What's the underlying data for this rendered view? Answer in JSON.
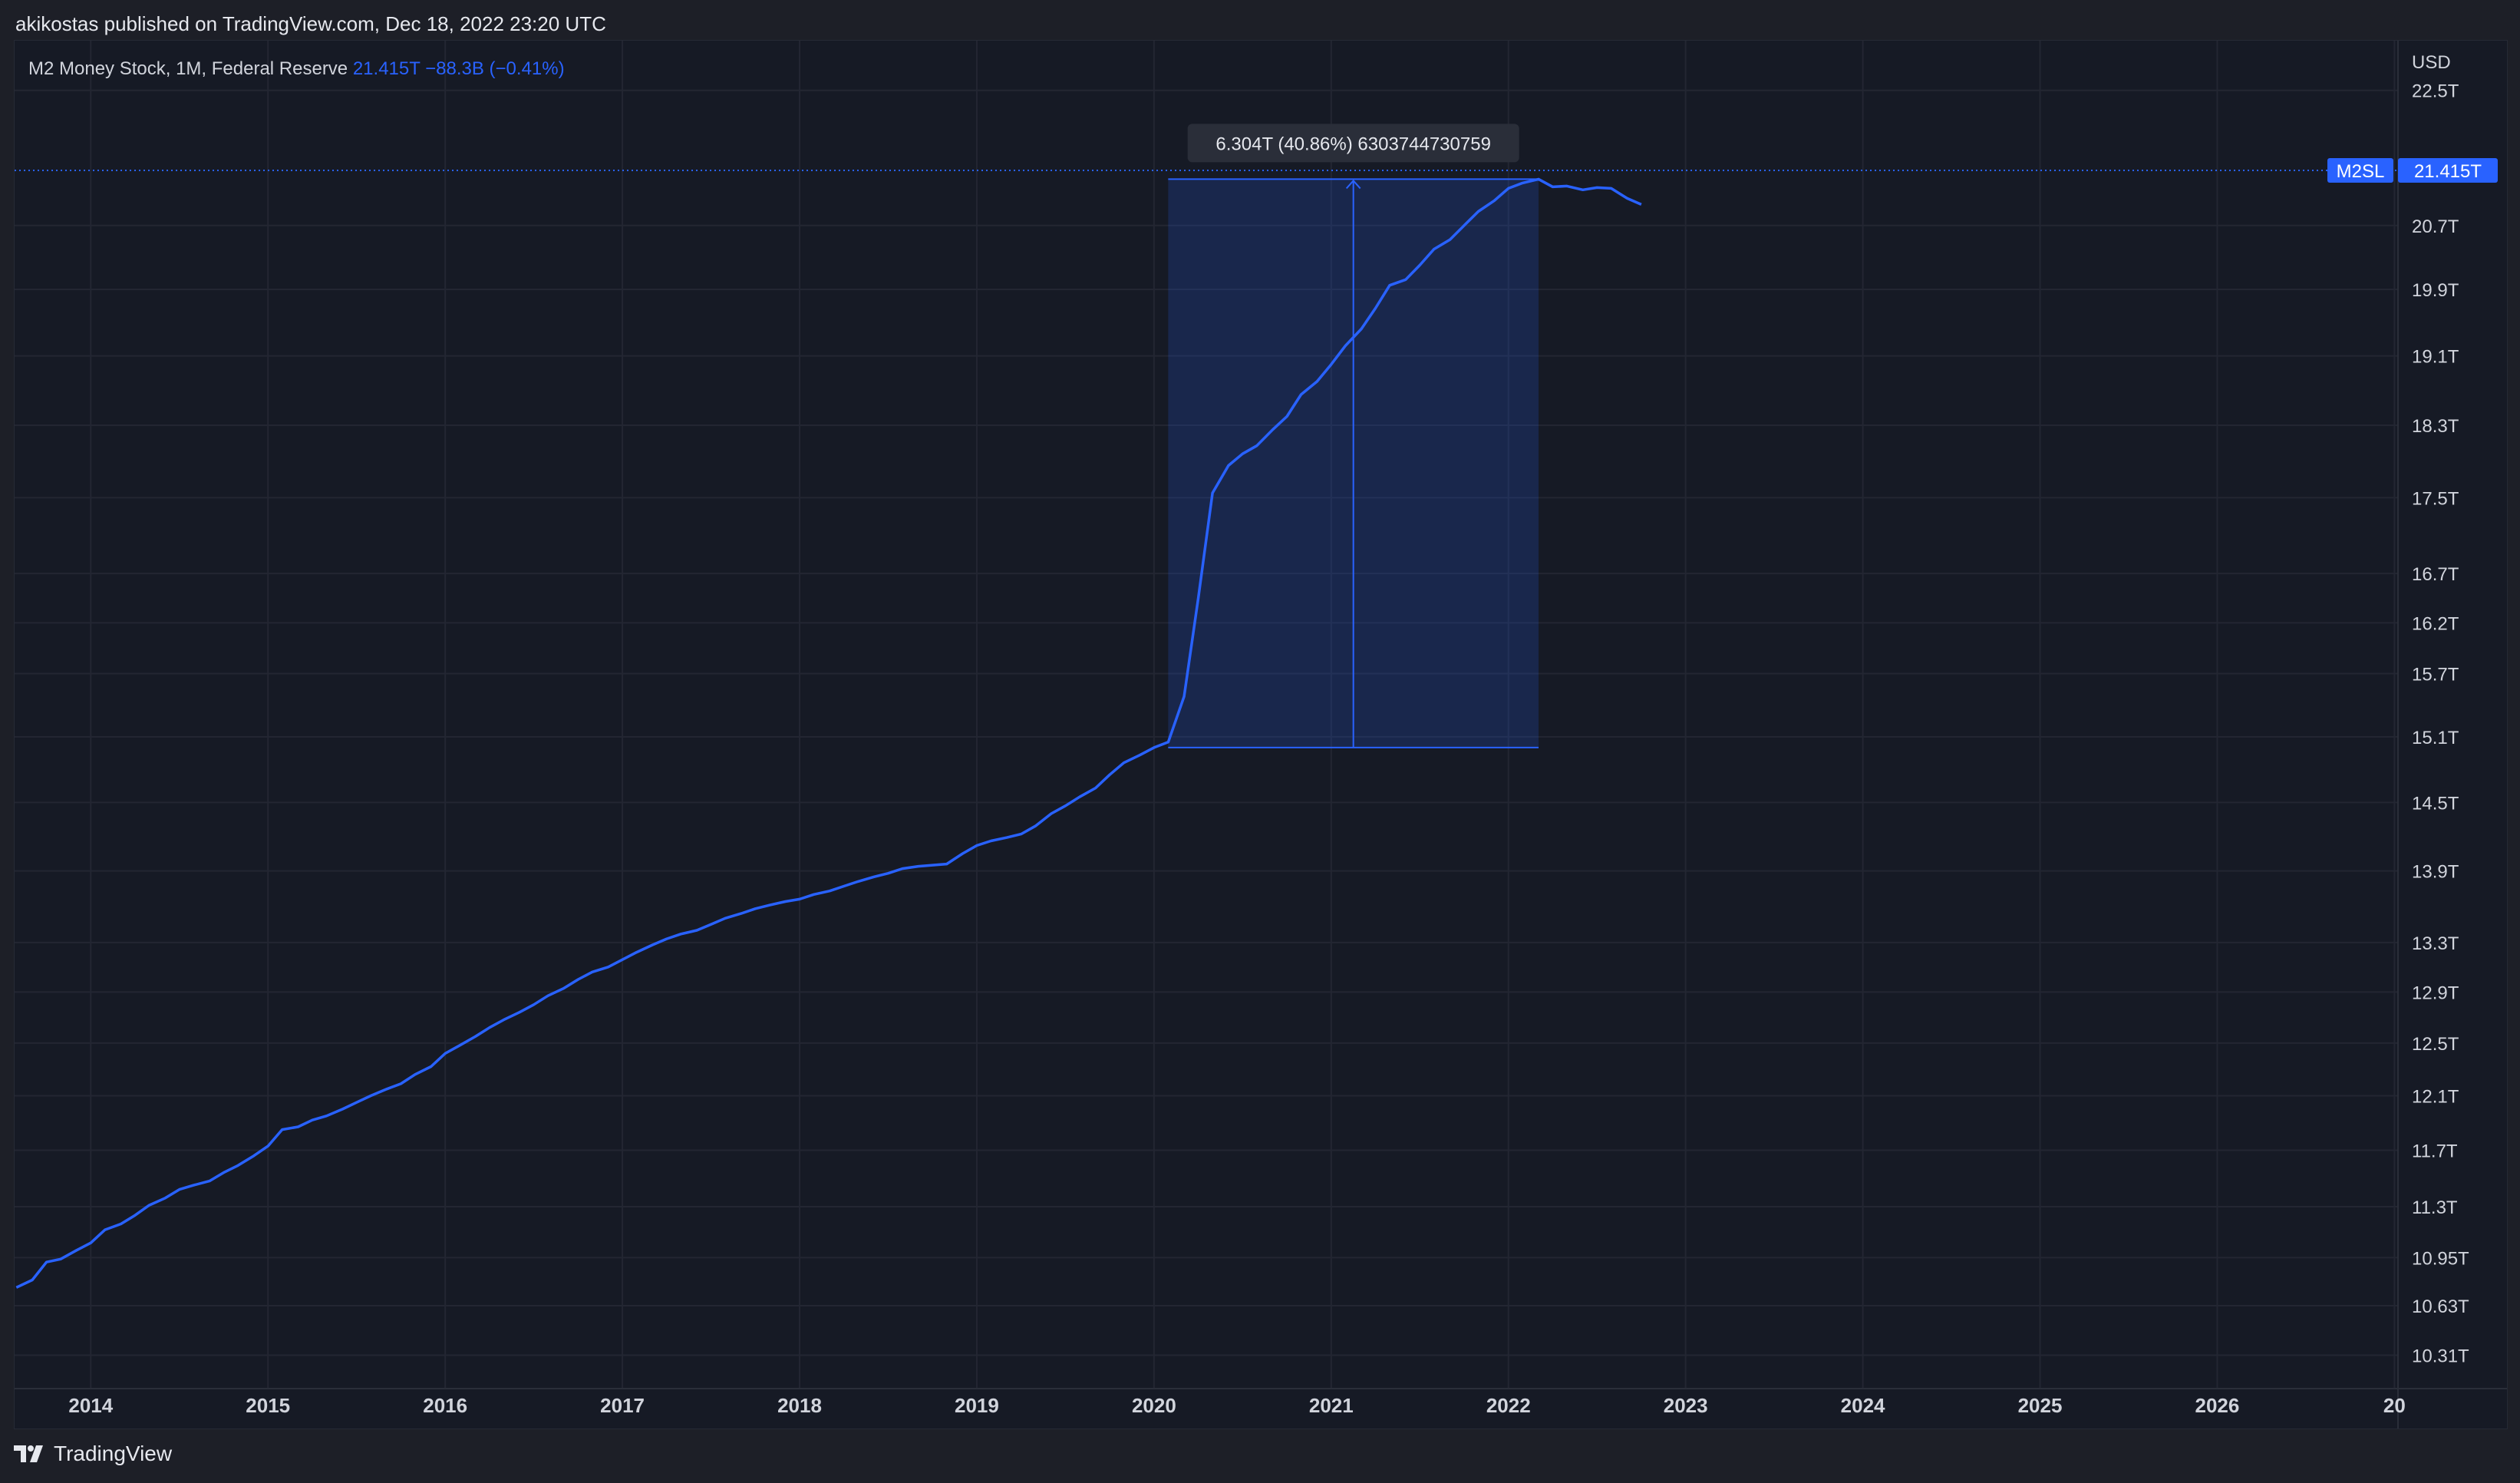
{
  "header": {
    "published_text": "akikostas published on TradingView.com, Dec 18, 2022 23:20 UTC"
  },
  "legend": {
    "title": "M2 Money Stock, 1M, Federal Reserve",
    "last_value": "21.415T",
    "change": "−88.3B (−0.41%)"
  },
  "price_scale": {
    "currency": "USD",
    "symbol_badge": "M2SL",
    "last_badge": "21.415T"
  },
  "measure_label": "6.304T (40.86%) 6303744730759",
  "footer": {
    "brand": "TradingView"
  },
  "colors": {
    "background": "#161a25",
    "series": "#2962ff",
    "grid": "#232632",
    "axis_text": "#d1d4dc",
    "measure_fill": "#2962ff",
    "badge": "#2962ff"
  },
  "chart_data": {
    "type": "line",
    "title": "M2 Money Stock, 1M, Federal Reserve",
    "ylabel": "USD",
    "y_scale": "log",
    "ylim": [
      10.1,
      23.2
    ],
    "y_ticks": [
      {
        "value": 22.5,
        "label": "22.5T"
      },
      {
        "value": 20.7,
        "label": "20.7T"
      },
      {
        "value": 19.9,
        "label": "19.9T"
      },
      {
        "value": 19.1,
        "label": "19.1T"
      },
      {
        "value": 18.3,
        "label": "18.3T"
      },
      {
        "value": 17.5,
        "label": "17.5T"
      },
      {
        "value": 16.7,
        "label": "16.7T"
      },
      {
        "value": 16.2,
        "label": "16.2T"
      },
      {
        "value": 15.7,
        "label": "15.7T"
      },
      {
        "value": 15.1,
        "label": "15.1T"
      },
      {
        "value": 14.5,
        "label": "14.5T"
      },
      {
        "value": 13.9,
        "label": "13.9T"
      },
      {
        "value": 13.3,
        "label": "13.3T"
      },
      {
        "value": 12.9,
        "label": "12.9T"
      },
      {
        "value": 12.5,
        "label": "12.5T"
      },
      {
        "value": 12.1,
        "label": "12.1T"
      },
      {
        "value": 11.7,
        "label": "11.7T"
      },
      {
        "value": 11.3,
        "label": "11.3T"
      },
      {
        "value": 10.95,
        "label": "10.95T"
      },
      {
        "value": 10.63,
        "label": "10.63T"
      },
      {
        "value": 10.31,
        "label": "10.31T"
      }
    ],
    "xlim": [
      2013.57,
      2027.02
    ],
    "x_ticks": [
      {
        "value": 2014,
        "label": "2014"
      },
      {
        "value": 2015,
        "label": "2015"
      },
      {
        "value": 2016,
        "label": "2016"
      },
      {
        "value": 2017,
        "label": "2017"
      },
      {
        "value": 2018,
        "label": "2018"
      },
      {
        "value": 2019,
        "label": "2019"
      },
      {
        "value": 2020,
        "label": "2020"
      },
      {
        "value": 2021,
        "label": "2021"
      },
      {
        "value": 2022,
        "label": "2022"
      },
      {
        "value": 2023,
        "label": "2023"
      },
      {
        "value": 2024,
        "label": "2024"
      },
      {
        "value": 2025,
        "label": "2025"
      },
      {
        "value": 2026,
        "label": "2026"
      },
      {
        "value": 2027,
        "label": "20"
      }
    ],
    "series": [
      {
        "points": [
          [
            2013.58,
            10.75
          ],
          [
            2013.67,
            10.8
          ],
          [
            2013.75,
            10.92
          ],
          [
            2013.83,
            10.94
          ],
          [
            2013.92,
            11.0
          ],
          [
            2014.0,
            11.05
          ],
          [
            2014.08,
            11.14
          ],
          [
            2014.17,
            11.18
          ],
          [
            2014.25,
            11.24
          ],
          [
            2014.33,
            11.31
          ],
          [
            2014.42,
            11.36
          ],
          [
            2014.5,
            11.42
          ],
          [
            2014.58,
            11.45
          ],
          [
            2014.67,
            11.48
          ],
          [
            2014.75,
            11.54
          ],
          [
            2014.83,
            11.59
          ],
          [
            2014.92,
            11.66
          ],
          [
            2015.0,
            11.73
          ],
          [
            2015.08,
            11.85
          ],
          [
            2015.17,
            11.87
          ],
          [
            2015.25,
            11.92
          ],
          [
            2015.33,
            11.95
          ],
          [
            2015.42,
            12.0
          ],
          [
            2015.5,
            12.05
          ],
          [
            2015.58,
            12.1
          ],
          [
            2015.67,
            12.15
          ],
          [
            2015.75,
            12.19
          ],
          [
            2015.83,
            12.26
          ],
          [
            2015.92,
            12.32
          ],
          [
            2016.0,
            12.42
          ],
          [
            2016.08,
            12.48
          ],
          [
            2016.17,
            12.55
          ],
          [
            2016.25,
            12.62
          ],
          [
            2016.33,
            12.68
          ],
          [
            2016.42,
            12.74
          ],
          [
            2016.5,
            12.8
          ],
          [
            2016.58,
            12.87
          ],
          [
            2016.67,
            12.93
          ],
          [
            2016.75,
            13.0
          ],
          [
            2016.83,
            13.06
          ],
          [
            2016.92,
            13.1
          ],
          [
            2017.0,
            13.16
          ],
          [
            2017.08,
            13.22
          ],
          [
            2017.17,
            13.28
          ],
          [
            2017.25,
            13.33
          ],
          [
            2017.33,
            13.37
          ],
          [
            2017.42,
            13.4
          ],
          [
            2017.5,
            13.45
          ],
          [
            2017.58,
            13.5
          ],
          [
            2017.67,
            13.54
          ],
          [
            2017.75,
            13.58
          ],
          [
            2017.83,
            13.61
          ],
          [
            2017.92,
            13.64
          ],
          [
            2018.0,
            13.66
          ],
          [
            2018.08,
            13.7
          ],
          [
            2018.17,
            13.73
          ],
          [
            2018.25,
            13.77
          ],
          [
            2018.33,
            13.81
          ],
          [
            2018.42,
            13.85
          ],
          [
            2018.5,
            13.88
          ],
          [
            2018.58,
            13.92
          ],
          [
            2018.67,
            13.94
          ],
          [
            2018.75,
            13.95
          ],
          [
            2018.83,
            13.96
          ],
          [
            2018.92,
            14.05
          ],
          [
            2019.0,
            14.12
          ],
          [
            2019.08,
            14.16
          ],
          [
            2019.17,
            14.19
          ],
          [
            2019.25,
            14.22
          ],
          [
            2019.33,
            14.29
          ],
          [
            2019.42,
            14.4
          ],
          [
            2019.5,
            14.47
          ],
          [
            2019.58,
            14.55
          ],
          [
            2019.67,
            14.63
          ],
          [
            2019.75,
            14.75
          ],
          [
            2019.83,
            14.86
          ],
          [
            2019.92,
            14.93
          ],
          [
            2020.0,
            15.0
          ],
          [
            2020.08,
            15.05
          ],
          [
            2020.17,
            15.48
          ],
          [
            2020.25,
            16.45
          ],
          [
            2020.33,
            17.55
          ],
          [
            2020.42,
            17.85
          ],
          [
            2020.5,
            17.98
          ],
          [
            2020.58,
            18.07
          ],
          [
            2020.67,
            18.25
          ],
          [
            2020.75,
            18.4
          ],
          [
            2020.83,
            18.65
          ],
          [
            2020.92,
            18.8
          ],
          [
            2021.0,
            19.0
          ],
          [
            2021.08,
            19.22
          ],
          [
            2021.17,
            19.42
          ],
          [
            2021.25,
            19.67
          ],
          [
            2021.33,
            19.95
          ],
          [
            2021.42,
            20.02
          ],
          [
            2021.5,
            20.2
          ],
          [
            2021.58,
            20.4
          ],
          [
            2021.67,
            20.52
          ],
          [
            2021.75,
            20.7
          ],
          [
            2021.83,
            20.88
          ],
          [
            2021.92,
            21.02
          ],
          [
            2022.0,
            21.18
          ],
          [
            2022.08,
            21.25
          ],
          [
            2022.17,
            21.3
          ],
          [
            2022.25,
            21.2
          ],
          [
            2022.33,
            21.21
          ],
          [
            2022.42,
            21.16
          ],
          [
            2022.5,
            21.19
          ],
          [
            2022.58,
            21.18
          ],
          [
            2022.67,
            21.05
          ],
          [
            2022.75,
            20.97
          ]
        ]
      }
    ],
    "last_value_line": 21.415,
    "measure": {
      "x_start": 2020.08,
      "x_end": 2022.17,
      "y_low": 15.0,
      "y_high": 21.3,
      "label": "6.304T (40.86%) 6303744730759"
    }
  }
}
